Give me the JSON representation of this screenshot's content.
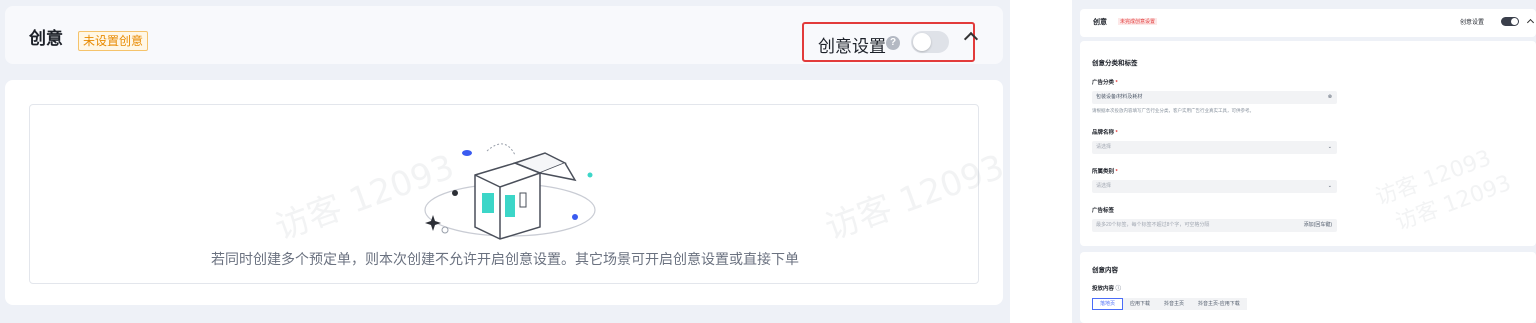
{
  "left_panel": {
    "title": "创意",
    "status_badge": "未设置创意",
    "setting_label": "创意设置",
    "help_icon": "?",
    "toggle_on": false,
    "empty_message": "若同时创建多个预定单，则本次创建不允许开启创意设置。其它场景可开启创意设置或直接下单",
    "watermarks": [
      "访客 12093",
      "访客 12093"
    ]
  },
  "right_panel": {
    "title": "创意",
    "status_badge": "未完成创意设置",
    "setting_label": "创意设置",
    "toggle_on": true,
    "section_category": "创意分类和标签",
    "ad_category_label": "广告分类",
    "ad_category_value": "包装设备/材料及耗材",
    "ad_category_hint": "请根据本次投放内容填写广告行业分类，客户实用广告行业真实工具，可供参考。",
    "brand_label": "品牌名称",
    "brand_placeholder": "请选择",
    "type_label": "所属类别",
    "type_placeholder": "请选择",
    "ad_tag_label": "广告标签",
    "ad_tag_placeholder": "最多20个标签，每个标签不超过8个字，可空格分隔",
    "ad_tag_action": "添加(回车键)",
    "required_mark": "*",
    "section_content": "创意内容",
    "delivery_label": "投放内容",
    "delivery_tabs": [
      "落地页",
      "应用下载",
      "抖音主页",
      "抖音主页-应用下载"
    ],
    "watermarks": [
      "访客 12093",
      "访客 12093"
    ]
  },
  "colors": {
    "highlight_border": "#e23b3b",
    "warn_badge": "#e88a00",
    "accent": "#4a6cf7"
  }
}
